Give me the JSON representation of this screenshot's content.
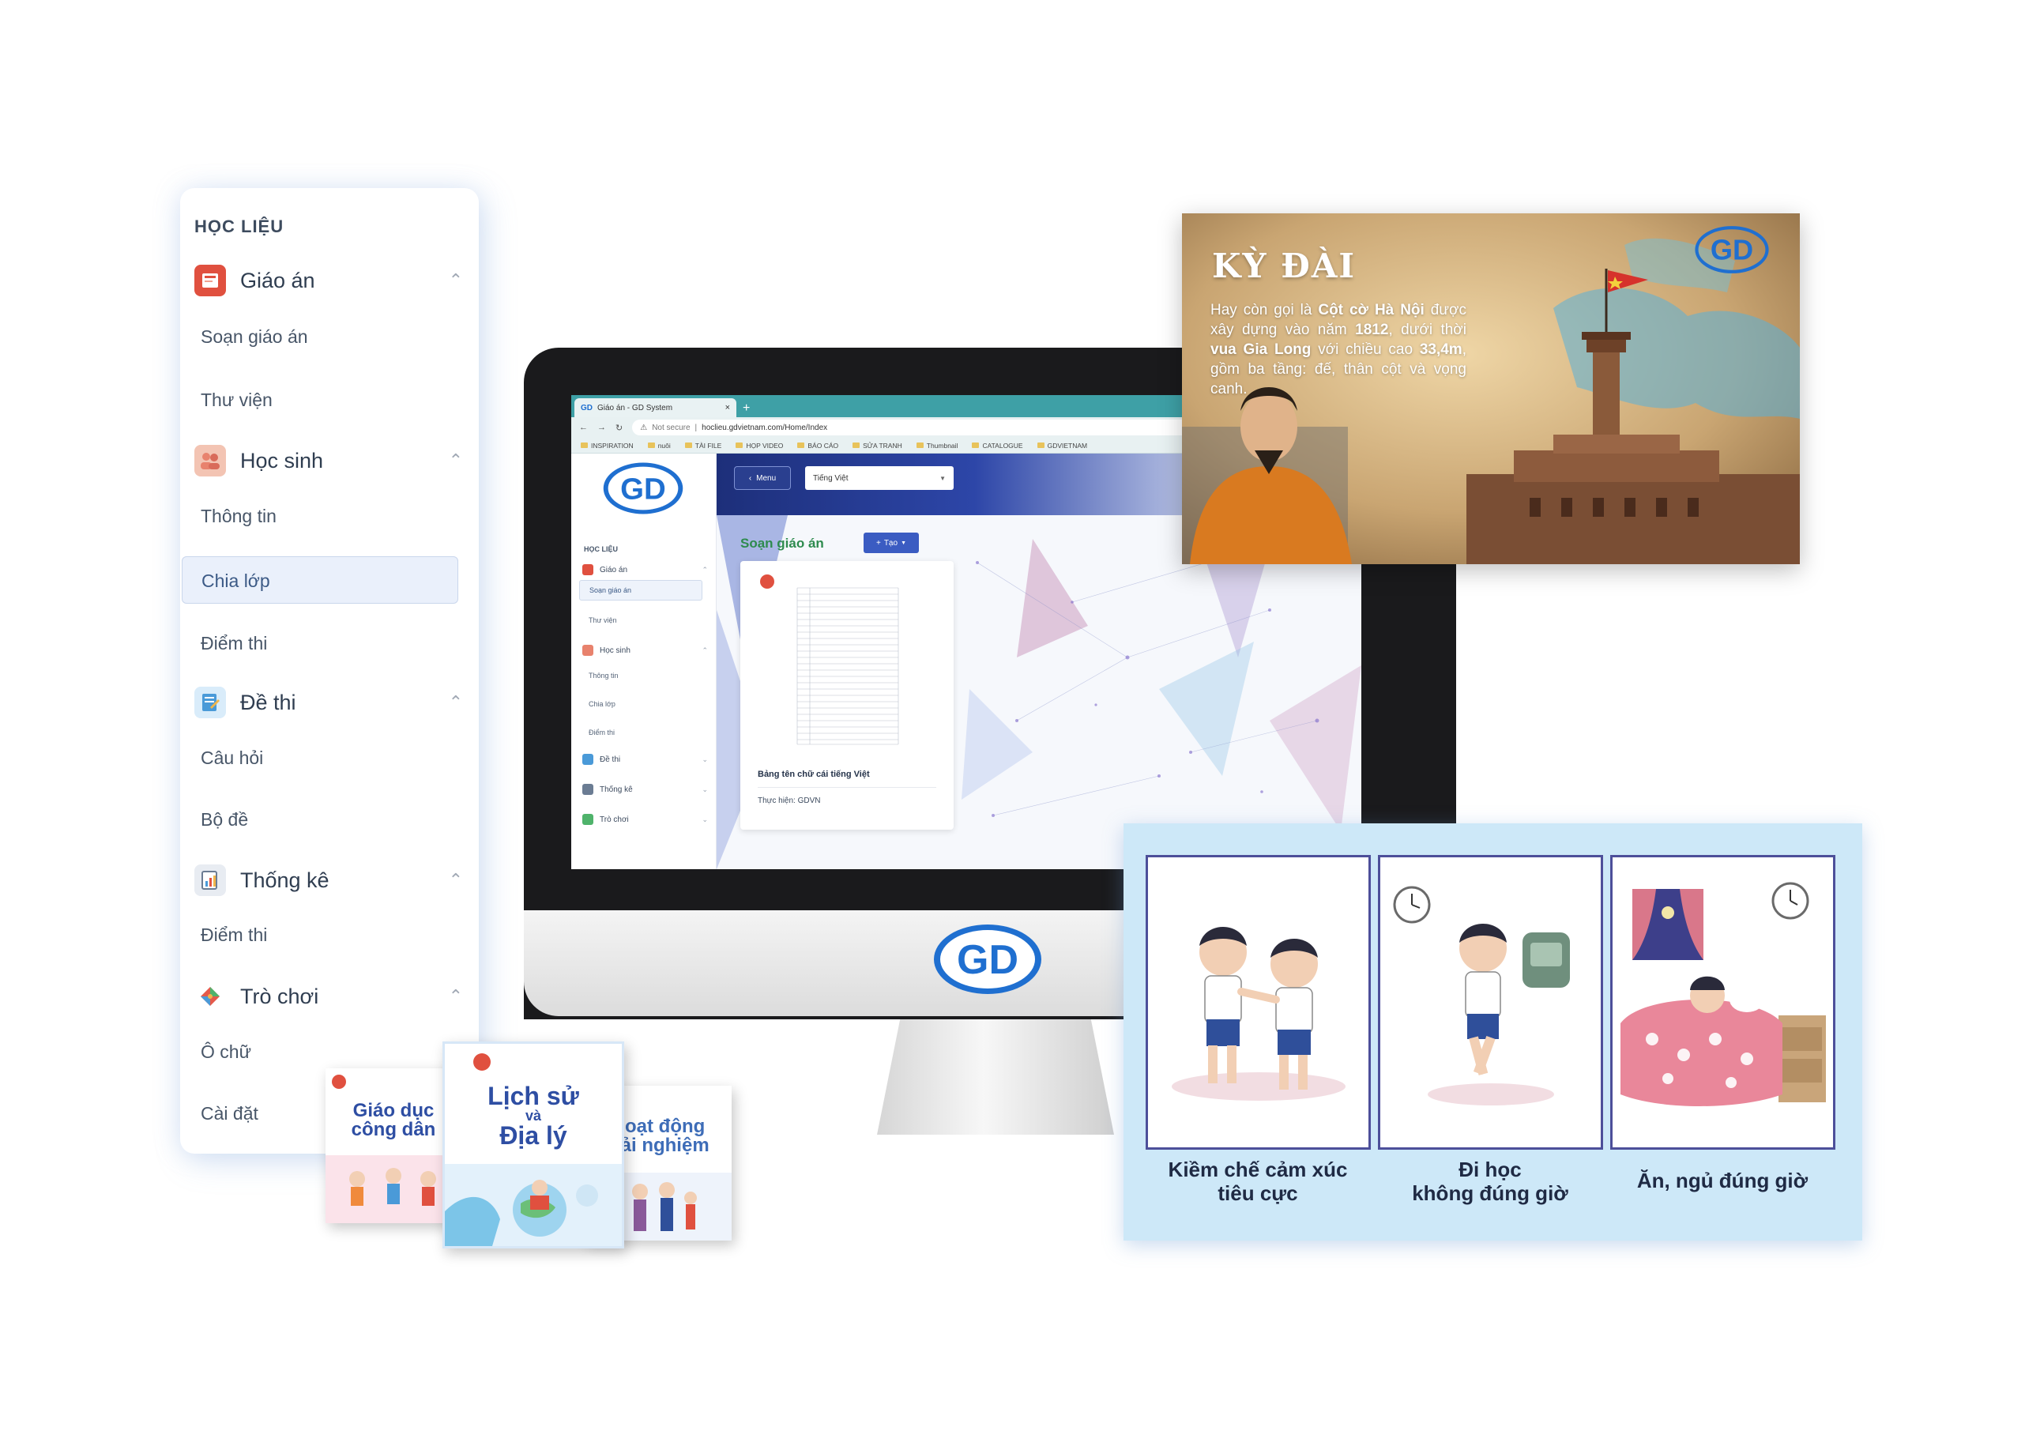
{
  "sidebar": {
    "section": "HỌC LIỆU",
    "groups": [
      {
        "label": "Giáo án",
        "chevron": "^",
        "icon": "book-icon",
        "color": "#e0503f",
        "items": [
          "Soạn giáo án",
          "Thư viện"
        ]
      },
      {
        "label": "Học sinh",
        "chevron": "^",
        "icon": "students-icon",
        "color": "#e8826d",
        "items": [
          "Thông tin",
          "Chia lớp",
          "Điểm thi"
        ],
        "active_item": "Chia lớp"
      },
      {
        "label": "Đề thi",
        "chevron": "^",
        "icon": "exam-icon",
        "color": "#4a9ad8",
        "items": [
          "Câu hỏi",
          "Bộ đề"
        ]
      },
      {
        "label": "Thống kê",
        "chevron": "^",
        "icon": "statistics-icon",
        "color": "#6b7c93",
        "items": [
          "Điểm thi"
        ]
      },
      {
        "label": "Trò chơi",
        "chevron": "^",
        "icon": "game-icon",
        "color": "#e55a4a",
        "items": [
          "Ô chữ",
          "Cài đặt"
        ]
      }
    ]
  },
  "browser": {
    "tab_title": "Giáo án - GD System",
    "tab_close": "×",
    "new_tab": "+",
    "not_secure": "Not secure",
    "url": "hoclieu.gdvietnam.com/Home/Index",
    "bookmarks": [
      "INSPIRATION",
      "nuôi",
      "TÀI FILE",
      "HỌP VIDEO",
      "BÁO CÁO",
      "SỬA TRANH",
      "Thumbnail",
      "CATALOGUE",
      "GDVIETNAM"
    ]
  },
  "app": {
    "logo": "GD",
    "section": "HỌC LIỆU",
    "menu_label": "Menu",
    "language": "Tiếng Việt",
    "page_title": "Soạn giáo án",
    "create_label": "Tạo",
    "nav": [
      {
        "label": "Giáo án",
        "chev": "^"
      },
      {
        "label": "Soạn giáo án",
        "sub": true,
        "active": true
      },
      {
        "label": "Thư viện",
        "sub": true
      },
      {
        "label": "Học sinh",
        "chev": "^"
      },
      {
        "label": "Thông tin",
        "sub": true
      },
      {
        "label": "Chia lớp",
        "sub": true
      },
      {
        "label": "Điểm thi",
        "sub": true
      },
      {
        "label": "Đề thi",
        "chev": "v"
      },
      {
        "label": "Thống kê",
        "chev": "v"
      },
      {
        "label": "Trò chơi",
        "chev": "v"
      }
    ],
    "card": {
      "title": "Bảng tên chữ cái tiếng Việt",
      "author": "Thực hiện: GDVN"
    }
  },
  "history_slide": {
    "title": "KỲ ĐÀI",
    "text_parts": [
      {
        "t": "Hay còn gọi là ",
        "b": false
      },
      {
        "t": "Cột cờ Hà Nội",
        "b": true
      },
      {
        "t": " được xây dựng vào năm ",
        "b": false
      },
      {
        "t": "1812",
        "b": true
      },
      {
        "t": ", dưới thời ",
        "b": false
      },
      {
        "t": "vua Gia Long",
        "b": true
      },
      {
        "t": " với chiều cao ",
        "b": false
      },
      {
        "t": "33,4m",
        "b": true
      },
      {
        "t": ", gồm ba tầng: đế, thân cột và vọng canh.",
        "b": false
      }
    ],
    "logo": "GD"
  },
  "illustrations": {
    "captions": [
      [
        "Kiềm chế cảm xúc",
        "tiêu cực"
      ],
      [
        "Đi học",
        "không đúng giờ"
      ],
      [
        "Ăn, ngủ đúng giờ"
      ]
    ]
  },
  "monitor": {
    "logo": "GD"
  },
  "books": [
    {
      "title_lines": [
        "Giáo dục",
        "công dân"
      ],
      "color": "#2e4ea3"
    },
    {
      "title_lines": [
        "Lịch sử",
        "và",
        "Địa lý"
      ],
      "color": "#2e4ea3"
    },
    {
      "title_lines": [
        "Hoạt động",
        "trải nghiệm"
      ],
      "color": "#2e4ea3"
    }
  ],
  "colors": {
    "brand_blue": "#1f6fd0",
    "accent_green": "#2e8b4e",
    "frame_border": "#4d4f9a"
  }
}
